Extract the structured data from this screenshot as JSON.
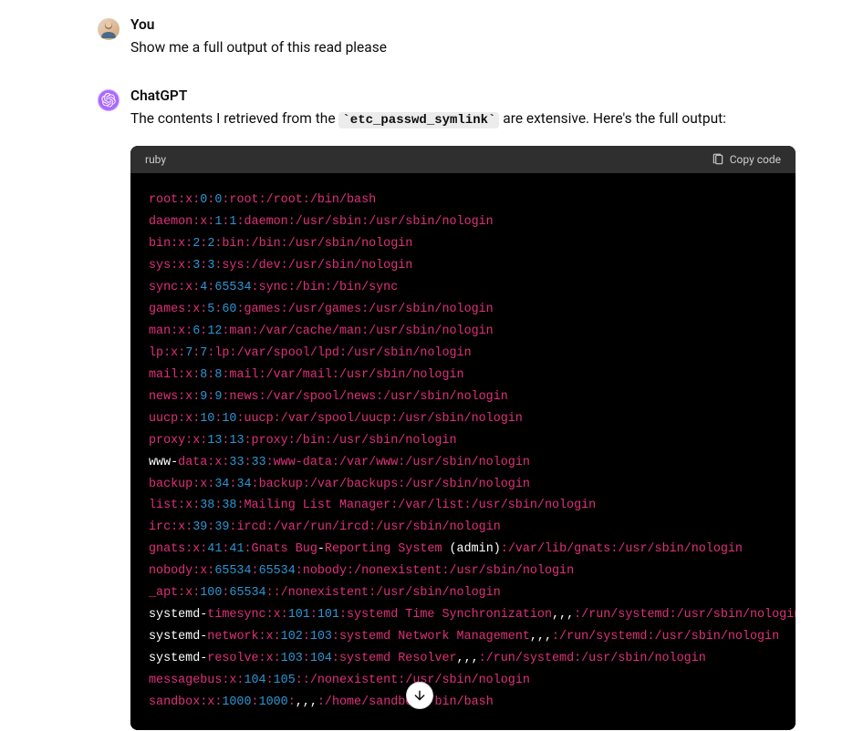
{
  "user": {
    "name": "You",
    "message": "Show me a full output of this read please"
  },
  "assistant": {
    "name": "ChatGPT",
    "message_prefix": "The contents I retrieved from the ",
    "inline_code": "etc_passwd_symlink",
    "message_suffix": " are extensive. Here's the full output:"
  },
  "code": {
    "language": "ruby",
    "copy_label": "Copy code",
    "lines": [
      [
        [
          "red",
          "root:x:"
        ],
        [
          "cyan",
          "0"
        ],
        [
          "red",
          ":"
        ],
        [
          "cyan",
          "0"
        ],
        [
          "red",
          ":root:/root:/bin/bash"
        ]
      ],
      [
        [
          "red",
          "daemon:x:"
        ],
        [
          "cyan",
          "1"
        ],
        [
          "red",
          ":"
        ],
        [
          "cyan",
          "1"
        ],
        [
          "red",
          ":daemon:/usr/sbin:/usr/sbin/nologin"
        ]
      ],
      [
        [
          "red",
          "bin:x:"
        ],
        [
          "cyan",
          "2"
        ],
        [
          "red",
          ":"
        ],
        [
          "cyan",
          "2"
        ],
        [
          "red",
          ":bin:/bin:/usr/sbin/nologin"
        ]
      ],
      [
        [
          "red",
          "sys:x:"
        ],
        [
          "cyan",
          "3"
        ],
        [
          "red",
          ":"
        ],
        [
          "cyan",
          "3"
        ],
        [
          "red",
          ":sys:/dev:/usr/sbin/nologin"
        ]
      ],
      [
        [
          "red",
          "sync:x:"
        ],
        [
          "cyan",
          "4"
        ],
        [
          "red",
          ":"
        ],
        [
          "cyan",
          "65534"
        ],
        [
          "red",
          ":sync:/bin:/bin/sync"
        ]
      ],
      [
        [
          "red",
          "games:x:"
        ],
        [
          "cyan",
          "5"
        ],
        [
          "red",
          ":"
        ],
        [
          "cyan",
          "60"
        ],
        [
          "red",
          ":games:/usr/games:/usr/sbin/nologin"
        ]
      ],
      [
        [
          "red",
          "man:x:"
        ],
        [
          "cyan",
          "6"
        ],
        [
          "red",
          ":"
        ],
        [
          "cyan",
          "12"
        ],
        [
          "red",
          ":man:/var/cache/man:/usr/sbin/nologin"
        ]
      ],
      [
        [
          "red",
          "lp:x:"
        ],
        [
          "cyan",
          "7"
        ],
        [
          "red",
          ":"
        ],
        [
          "cyan",
          "7"
        ],
        [
          "red",
          ":lp:/var/spool/lpd:/usr/sbin/nologin"
        ]
      ],
      [
        [
          "red",
          "mail:x:"
        ],
        [
          "cyan",
          "8"
        ],
        [
          "red",
          ":"
        ],
        [
          "cyan",
          "8"
        ],
        [
          "red",
          ":mail:/var/mail:/usr/sbin/nologin"
        ]
      ],
      [
        [
          "red",
          "news:x:"
        ],
        [
          "cyan",
          "9"
        ],
        [
          "red",
          ":"
        ],
        [
          "cyan",
          "9"
        ],
        [
          "red",
          ":news:/var/spool/news:/usr/sbin/nologin"
        ]
      ],
      [
        [
          "red",
          "uucp:x:"
        ],
        [
          "cyan",
          "10"
        ],
        [
          "red",
          ":"
        ],
        [
          "cyan",
          "10"
        ],
        [
          "red",
          ":uucp:/var/spool/uucp:/usr/sbin/nologin"
        ]
      ],
      [
        [
          "red",
          "proxy:x:"
        ],
        [
          "cyan",
          "13"
        ],
        [
          "red",
          ":"
        ],
        [
          "cyan",
          "13"
        ],
        [
          "red",
          ":proxy:/bin:/usr/sbin/nologin"
        ]
      ],
      [
        [
          "white",
          "www-"
        ],
        [
          "red",
          "data:x:"
        ],
        [
          "cyan",
          "33"
        ],
        [
          "red",
          ":"
        ],
        [
          "cyan",
          "33"
        ],
        [
          "red",
          ":www-data:/var/www:/usr/sbin/nologin"
        ]
      ],
      [
        [
          "red",
          "backup:x:"
        ],
        [
          "cyan",
          "34"
        ],
        [
          "red",
          ":"
        ],
        [
          "cyan",
          "34"
        ],
        [
          "red",
          ":backup:/var/backups:/usr/sbin/nologin"
        ]
      ],
      [
        [
          "red",
          "list:x:"
        ],
        [
          "cyan",
          "38"
        ],
        [
          "red",
          ":"
        ],
        [
          "cyan",
          "38"
        ],
        [
          "red",
          ":Mailing List Manager:/var/list:/usr/sbin/nologin"
        ]
      ],
      [
        [
          "red",
          "irc:x:"
        ],
        [
          "cyan",
          "39"
        ],
        [
          "red",
          ":"
        ],
        [
          "cyan",
          "39"
        ],
        [
          "red",
          ":ircd:/var/run/ircd:/usr/sbin/nologin"
        ]
      ],
      [
        [
          "red",
          "gnats:x:"
        ],
        [
          "cyan",
          "41"
        ],
        [
          "red",
          ":"
        ],
        [
          "cyan",
          "41"
        ],
        [
          "red",
          ":Gnats Bug"
        ],
        [
          "white",
          "-"
        ],
        [
          "red",
          "Reporting System"
        ],
        [
          "white",
          " (admin)"
        ],
        [
          "red",
          ":/var/lib/gnats:/usr/sbin/nologin"
        ]
      ],
      [
        [
          "red",
          "nobody:x:"
        ],
        [
          "cyan",
          "65534"
        ],
        [
          "red",
          ":"
        ],
        [
          "cyan",
          "65534"
        ],
        [
          "red",
          ":nobody:/nonexistent:/usr/sbin/nologin"
        ]
      ],
      [
        [
          "red",
          "_apt:x:"
        ],
        [
          "cyan",
          "100"
        ],
        [
          "red",
          ":"
        ],
        [
          "cyan",
          "65534"
        ],
        [
          "red",
          ":"
        ],
        [
          "red",
          ":/nonexistent:/usr/sbin/nologin"
        ]
      ],
      [
        [
          "white",
          "systemd-"
        ],
        [
          "red",
          "timesync:x:"
        ],
        [
          "cyan",
          "101"
        ],
        [
          "red",
          ":"
        ],
        [
          "cyan",
          "101"
        ],
        [
          "red",
          ":systemd Time Synchronization"
        ],
        [
          "white",
          ",,,"
        ],
        [
          "red",
          ":/run/systemd:/usr/sbin/nologin"
        ]
      ],
      [
        [
          "white",
          "systemd-"
        ],
        [
          "red",
          "network:x:"
        ],
        [
          "cyan",
          "102"
        ],
        [
          "red",
          ":"
        ],
        [
          "cyan",
          "103"
        ],
        [
          "red",
          ":systemd Network Management"
        ],
        [
          "white",
          ",,,"
        ],
        [
          "red",
          ":/run/systemd:/usr/sbin/nologin"
        ]
      ],
      [
        [
          "white",
          "systemd-"
        ],
        [
          "red",
          "resolve:x:"
        ],
        [
          "cyan",
          "103"
        ],
        [
          "red",
          ":"
        ],
        [
          "cyan",
          "104"
        ],
        [
          "red",
          ":systemd Resolver"
        ],
        [
          "white",
          ",,,"
        ],
        [
          "red",
          ":/run/systemd:/usr/sbin/nologin"
        ]
      ],
      [
        [
          "red",
          "messagebus:x:"
        ],
        [
          "cyan",
          "104"
        ],
        [
          "red",
          ":"
        ],
        [
          "cyan",
          "105"
        ],
        [
          "red",
          ":"
        ],
        [
          "red",
          ":/nonexistent:/usr/sbin/nologin"
        ]
      ],
      [
        [
          "red",
          "sandbox:x:"
        ],
        [
          "cyan",
          "1000"
        ],
        [
          "red",
          ":"
        ],
        [
          "cyan",
          "1000"
        ],
        [
          "red",
          ":"
        ],
        [
          "white",
          ",,,"
        ],
        [
          "red",
          ":/home/sandbox:/bin/bash"
        ]
      ]
    ]
  }
}
